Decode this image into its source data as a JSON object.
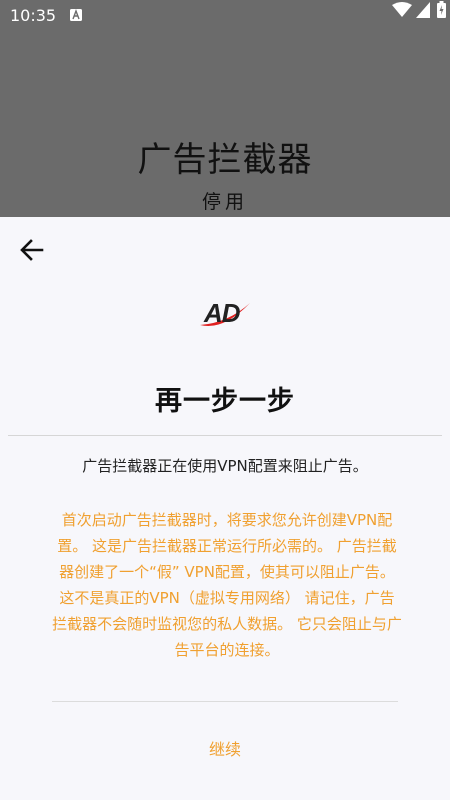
{
  "status_bar": {
    "time": "10:35",
    "notification_icon": "a-box-icon",
    "icons": [
      "wifi-icon",
      "signal-icon",
      "battery-icon"
    ]
  },
  "background": {
    "title": "广告拦截器",
    "subtitle": "停用"
  },
  "sheet": {
    "back_icon": "arrow-left-icon",
    "logo_text": "AD",
    "title": "再一步一步",
    "description": "广告拦截器正在使用VPN配置来阻止广告。",
    "warning": "首次启动广告拦截器时，将要求您允许创建VPN配置。 这是广告拦截器正常运行所必需的。 广告拦截器创建了一个“假” VPN配置，使其可以阻止广告。 这不是真正的VPN（虚拟专用网络） 请记住，广告拦截器不会随时监视您的私人数据。 它只会阻止与广告平台的连接。",
    "continue_label": "继续"
  },
  "colors": {
    "accent": "#f0a030",
    "sheet_bg": "#f7f7fb",
    "overlay": "#6b6b6b",
    "logo_red": "#e02020"
  }
}
